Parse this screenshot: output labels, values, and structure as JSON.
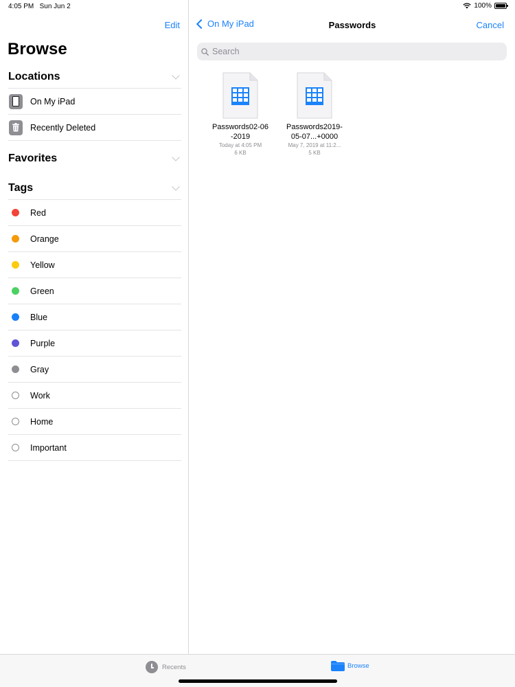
{
  "status_bar": {
    "time": "4:05 PM",
    "date": "Sun Jun 2",
    "battery": "100%",
    "battery_level": 1.0
  },
  "sidebar": {
    "edit_label": "Edit",
    "title": "Browse",
    "locations_header": "Locations",
    "locations": [
      {
        "label": "On My iPad",
        "icon": "ipad-icon"
      },
      {
        "label": "Recently Deleted",
        "icon": "trash-icon"
      }
    ],
    "favorites_header": "Favorites",
    "tags_header": "Tags",
    "tags": [
      {
        "label": "Red",
        "color": "#f24438"
      },
      {
        "label": "Orange",
        "color": "#f59a0a"
      },
      {
        "label": "Yellow",
        "color": "#fccb0f"
      },
      {
        "label": "Green",
        "color": "#4bd163"
      },
      {
        "label": "Blue",
        "color": "#1a80f8"
      },
      {
        "label": "Purple",
        "color": "#5f55d6"
      },
      {
        "label": "Gray",
        "color": "#8e8e93"
      },
      {
        "label": "Work",
        "color": ""
      },
      {
        "label": "Home",
        "color": ""
      },
      {
        "label": "Important",
        "color": ""
      }
    ]
  },
  "main": {
    "back_label": "On My iPad",
    "title": "Passwords",
    "cancel_label": "Cancel",
    "search_placeholder": "Search",
    "files": [
      {
        "name_line1": "Passwords02-06",
        "name_line2": "-2019",
        "date": "Today at 4:05 PM",
        "size": "6 KB",
        "icon": "spreadsheet-icon"
      },
      {
        "name_line1": "Passwords2019-",
        "name_line2": "05-07...+0000",
        "date": "May 7, 2019 at 11:2...",
        "size": "5 KB",
        "icon": "spreadsheet-icon"
      }
    ]
  },
  "tab_bar": {
    "recents_label": "Recents",
    "browse_label": "Browse"
  },
  "colors": {
    "accent": "#1a82fb",
    "secondary_text": "#8e8e93"
  }
}
